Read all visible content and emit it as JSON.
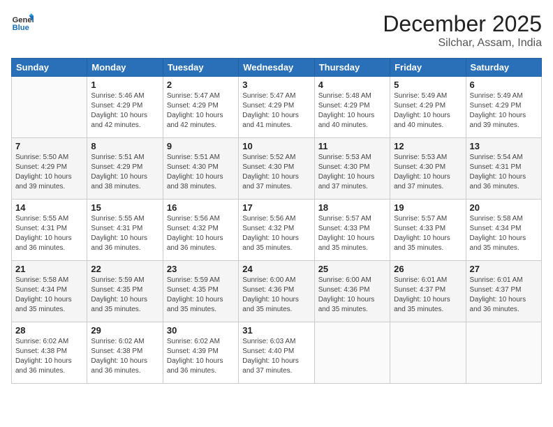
{
  "header": {
    "logo_general": "General",
    "logo_blue": "Blue",
    "month_year": "December 2025",
    "location": "Silchar, Assam, India"
  },
  "weekdays": [
    "Sunday",
    "Monday",
    "Tuesday",
    "Wednesday",
    "Thursday",
    "Friday",
    "Saturday"
  ],
  "weeks": [
    [
      {
        "day": "",
        "info": ""
      },
      {
        "day": "1",
        "info": "Sunrise: 5:46 AM\nSunset: 4:29 PM\nDaylight: 10 hours\nand 42 minutes."
      },
      {
        "day": "2",
        "info": "Sunrise: 5:47 AM\nSunset: 4:29 PM\nDaylight: 10 hours\nand 42 minutes."
      },
      {
        "day": "3",
        "info": "Sunrise: 5:47 AM\nSunset: 4:29 PM\nDaylight: 10 hours\nand 41 minutes."
      },
      {
        "day": "4",
        "info": "Sunrise: 5:48 AM\nSunset: 4:29 PM\nDaylight: 10 hours\nand 40 minutes."
      },
      {
        "day": "5",
        "info": "Sunrise: 5:49 AM\nSunset: 4:29 PM\nDaylight: 10 hours\nand 40 minutes."
      },
      {
        "day": "6",
        "info": "Sunrise: 5:49 AM\nSunset: 4:29 PM\nDaylight: 10 hours\nand 39 minutes."
      }
    ],
    [
      {
        "day": "7",
        "info": "Sunrise: 5:50 AM\nSunset: 4:29 PM\nDaylight: 10 hours\nand 39 minutes."
      },
      {
        "day": "8",
        "info": "Sunrise: 5:51 AM\nSunset: 4:29 PM\nDaylight: 10 hours\nand 38 minutes."
      },
      {
        "day": "9",
        "info": "Sunrise: 5:51 AM\nSunset: 4:30 PM\nDaylight: 10 hours\nand 38 minutes."
      },
      {
        "day": "10",
        "info": "Sunrise: 5:52 AM\nSunset: 4:30 PM\nDaylight: 10 hours\nand 37 minutes."
      },
      {
        "day": "11",
        "info": "Sunrise: 5:53 AM\nSunset: 4:30 PM\nDaylight: 10 hours\nand 37 minutes."
      },
      {
        "day": "12",
        "info": "Sunrise: 5:53 AM\nSunset: 4:30 PM\nDaylight: 10 hours\nand 37 minutes."
      },
      {
        "day": "13",
        "info": "Sunrise: 5:54 AM\nSunset: 4:31 PM\nDaylight: 10 hours\nand 36 minutes."
      }
    ],
    [
      {
        "day": "14",
        "info": "Sunrise: 5:55 AM\nSunset: 4:31 PM\nDaylight: 10 hours\nand 36 minutes."
      },
      {
        "day": "15",
        "info": "Sunrise: 5:55 AM\nSunset: 4:31 PM\nDaylight: 10 hours\nand 36 minutes."
      },
      {
        "day": "16",
        "info": "Sunrise: 5:56 AM\nSunset: 4:32 PM\nDaylight: 10 hours\nand 36 minutes."
      },
      {
        "day": "17",
        "info": "Sunrise: 5:56 AM\nSunset: 4:32 PM\nDaylight: 10 hours\nand 35 minutes."
      },
      {
        "day": "18",
        "info": "Sunrise: 5:57 AM\nSunset: 4:33 PM\nDaylight: 10 hours\nand 35 minutes."
      },
      {
        "day": "19",
        "info": "Sunrise: 5:57 AM\nSunset: 4:33 PM\nDaylight: 10 hours\nand 35 minutes."
      },
      {
        "day": "20",
        "info": "Sunrise: 5:58 AM\nSunset: 4:34 PM\nDaylight: 10 hours\nand 35 minutes."
      }
    ],
    [
      {
        "day": "21",
        "info": "Sunrise: 5:58 AM\nSunset: 4:34 PM\nDaylight: 10 hours\nand 35 minutes."
      },
      {
        "day": "22",
        "info": "Sunrise: 5:59 AM\nSunset: 4:35 PM\nDaylight: 10 hours\nand 35 minutes."
      },
      {
        "day": "23",
        "info": "Sunrise: 5:59 AM\nSunset: 4:35 PM\nDaylight: 10 hours\nand 35 minutes."
      },
      {
        "day": "24",
        "info": "Sunrise: 6:00 AM\nSunset: 4:36 PM\nDaylight: 10 hours\nand 35 minutes."
      },
      {
        "day": "25",
        "info": "Sunrise: 6:00 AM\nSunset: 4:36 PM\nDaylight: 10 hours\nand 35 minutes."
      },
      {
        "day": "26",
        "info": "Sunrise: 6:01 AM\nSunset: 4:37 PM\nDaylight: 10 hours\nand 35 minutes."
      },
      {
        "day": "27",
        "info": "Sunrise: 6:01 AM\nSunset: 4:37 PM\nDaylight: 10 hours\nand 36 minutes."
      }
    ],
    [
      {
        "day": "28",
        "info": "Sunrise: 6:02 AM\nSunset: 4:38 PM\nDaylight: 10 hours\nand 36 minutes."
      },
      {
        "day": "29",
        "info": "Sunrise: 6:02 AM\nSunset: 4:38 PM\nDaylight: 10 hours\nand 36 minutes."
      },
      {
        "day": "30",
        "info": "Sunrise: 6:02 AM\nSunset: 4:39 PM\nDaylight: 10 hours\nand 36 minutes."
      },
      {
        "day": "31",
        "info": "Sunrise: 6:03 AM\nSunset: 4:40 PM\nDaylight: 10 hours\nand 37 minutes."
      },
      {
        "day": "",
        "info": ""
      },
      {
        "day": "",
        "info": ""
      },
      {
        "day": "",
        "info": ""
      }
    ]
  ]
}
